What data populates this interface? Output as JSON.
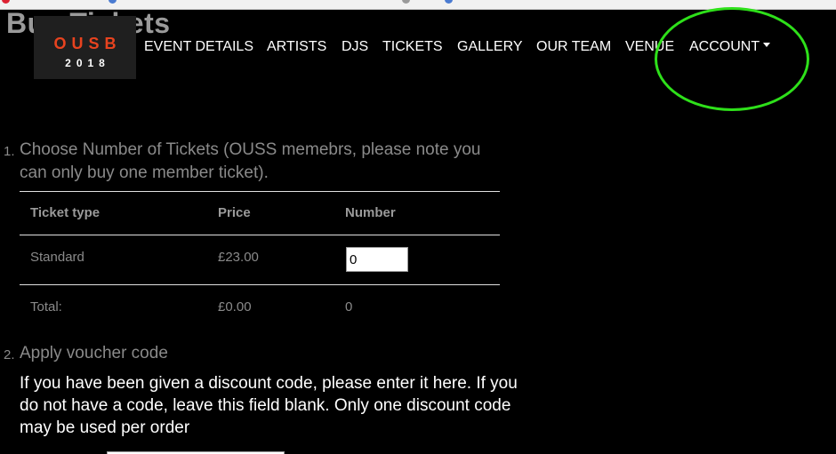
{
  "page": {
    "title": "Buy Tickets"
  },
  "logo": {
    "top_text": "OUSB",
    "bottom_text": "2018"
  },
  "nav": {
    "items": [
      {
        "label": "EVENT DETAILS"
      },
      {
        "label": "ARTISTS"
      },
      {
        "label": "DJS"
      },
      {
        "label": "TICKETS"
      },
      {
        "label": "GALLERY"
      },
      {
        "label": "OUR TEAM"
      },
      {
        "label": "VENUE"
      }
    ],
    "account_label": "ACCOUNT"
  },
  "step1": {
    "number": "1.",
    "title": "Choose Number of Tickets (OUSS memebrs, please note you can only buy one member ticket)."
  },
  "ticket_table": {
    "columns": [
      "Ticket type",
      "Price",
      "Number"
    ],
    "rows": [
      {
        "type": "Standard",
        "price": "£23.00",
        "number": "0"
      }
    ],
    "total": {
      "label": "Total:",
      "price": "£0.00",
      "number": "0"
    }
  },
  "step2": {
    "number": "2.",
    "title": "Apply voucher code",
    "description": "If you have been given a discount code, please enter it here. If you do not have a code, leave this field blank. Only one discount code may be used per order"
  },
  "colors": {
    "background": "#000000",
    "logo_accent": "#e8431f",
    "annotation": "#2ee01a",
    "muted_text": "#8a8a8a"
  }
}
